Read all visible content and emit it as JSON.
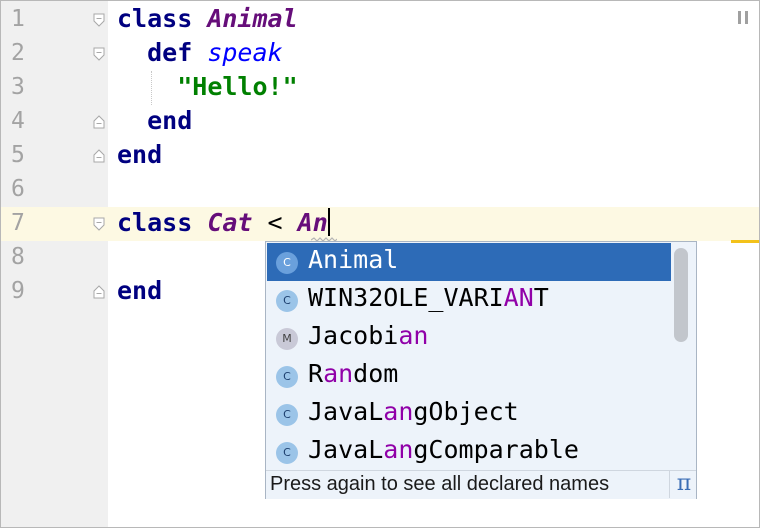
{
  "editor": {
    "lines": [
      {
        "num": "1",
        "tokens": [
          {
            "t": "class",
            "c": "kw"
          },
          {
            "t": " "
          },
          {
            "t": "Animal",
            "c": "cls"
          }
        ]
      },
      {
        "num": "2",
        "tokens": [
          {
            "t": "  "
          },
          {
            "t": "def",
            "c": "kw"
          },
          {
            "t": " "
          },
          {
            "t": "speak",
            "c": "meth"
          }
        ]
      },
      {
        "num": "3",
        "tokens": [
          {
            "t": "    "
          },
          {
            "t": "\"Hello!\"",
            "c": "str"
          }
        ]
      },
      {
        "num": "4",
        "tokens": [
          {
            "t": "  "
          },
          {
            "t": "end",
            "c": "kw"
          }
        ]
      },
      {
        "num": "5",
        "tokens": [
          {
            "t": "end",
            "c": "kw"
          }
        ]
      },
      {
        "num": "6",
        "tokens": []
      },
      {
        "num": "7",
        "tokens": [
          {
            "t": "class",
            "c": "kw"
          },
          {
            "t": " "
          },
          {
            "t": "Cat",
            "c": "cls"
          },
          {
            "t": " < ",
            "c": "op"
          },
          {
            "t": "An",
            "c": "cls"
          }
        ],
        "current": true,
        "caret": true
      },
      {
        "num": "8",
        "tokens": []
      },
      {
        "num": "9",
        "tokens": [
          {
            "t": "end",
            "c": "kw"
          }
        ]
      }
    ],
    "fold_markers": [
      {
        "line": 1,
        "kind": "open"
      },
      {
        "line": 2,
        "kind": "open"
      },
      {
        "line": 4,
        "kind": "close"
      },
      {
        "line": 5,
        "kind": "close"
      },
      {
        "line": 7,
        "kind": "open"
      },
      {
        "line": 9,
        "kind": "close"
      }
    ],
    "colors": {
      "keyword": "#000080",
      "class_name": "#660e7a",
      "method_name": "#0000ff",
      "string": "#008000",
      "current_line": "#fdf9e3",
      "gutter": "#f0f0f0",
      "selection": "#2d6bb7",
      "match_highlight": "#9000a8"
    }
  },
  "completion": {
    "items": [
      {
        "icon": "C",
        "icon_name": "class-icon",
        "parts": [
          {
            "t": "Animal"
          }
        ],
        "selected": true
      },
      {
        "icon": "C",
        "icon_name": "class-icon",
        "parts": [
          {
            "t": "WIN32OLE_VARI"
          },
          {
            "t": "AN",
            "h": true
          },
          {
            "t": "T"
          }
        ]
      },
      {
        "icon": "M",
        "icon_name": "module-icon",
        "parts": [
          {
            "t": "Jacobi"
          },
          {
            "t": "an",
            "h": true
          }
        ]
      },
      {
        "icon": "C",
        "icon_name": "class-icon",
        "parts": [
          {
            "t": "R"
          },
          {
            "t": "an",
            "h": true
          },
          {
            "t": "dom"
          }
        ]
      },
      {
        "icon": "C",
        "icon_name": "class-icon",
        "parts": [
          {
            "t": "JavaL"
          },
          {
            "t": "an",
            "h": true
          },
          {
            "t": "gObject"
          }
        ]
      },
      {
        "icon": "C",
        "icon_name": "class-icon",
        "parts": [
          {
            "t": "JavaL"
          },
          {
            "t": "an",
            "h": true
          },
          {
            "t": "gComparable"
          }
        ]
      }
    ],
    "footer_hint": "Press again to see all declared names",
    "pi_symbol": "π"
  }
}
